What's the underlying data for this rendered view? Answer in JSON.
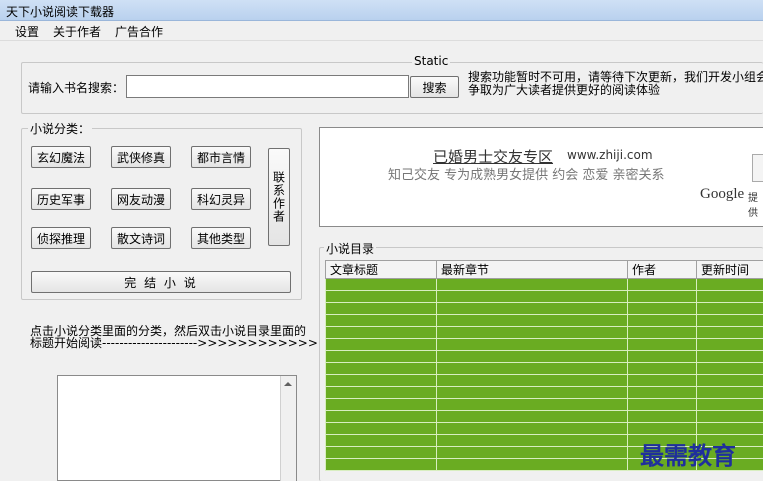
{
  "window": {
    "title": "天下小说阅读下载器"
  },
  "menu": [
    "设置",
    "关于作者",
    "广告合作"
  ],
  "search": {
    "group_label": "Static",
    "label": "请输入书名搜索：",
    "value": "",
    "button": "搜索",
    "notice": "搜索功能暂时不可用，请等待下次更新，我们开发小组会\n争取为广大读者提供更好的阅读体验"
  },
  "categories": {
    "group_label": "小说分类：",
    "items": [
      "玄幻魔法",
      "武侠修真",
      "都市言情",
      "历史军事",
      "网友动漫",
      "科幻灵异",
      "侦探推理",
      "散文诗词",
      "其他类型"
    ],
    "contact": "联系作者",
    "finished": "完 结 小 说"
  },
  "instruction": "点击小说分类里面的分类，然后双击小说目录里面的\n标题开始阅读---------------------->>>>>>>>>>>>>",
  "ad": {
    "link": "已婚男士交友专区",
    "url": "www.zhiji.com",
    "desc": "知己交友 专为成熟男女提供 约会 恋爱 亲密关系",
    "provider": "Google",
    "provider_suffix": "提供"
  },
  "catalog": {
    "group_label": "小说目录",
    "columns": [
      "文章标题",
      "最新章节",
      "作者",
      "更新时间"
    ],
    "rows": 16
  },
  "watermark": "最需教育",
  "colors": {
    "row_green": "#6aac22",
    "title_bar": "#c4d9f2"
  }
}
